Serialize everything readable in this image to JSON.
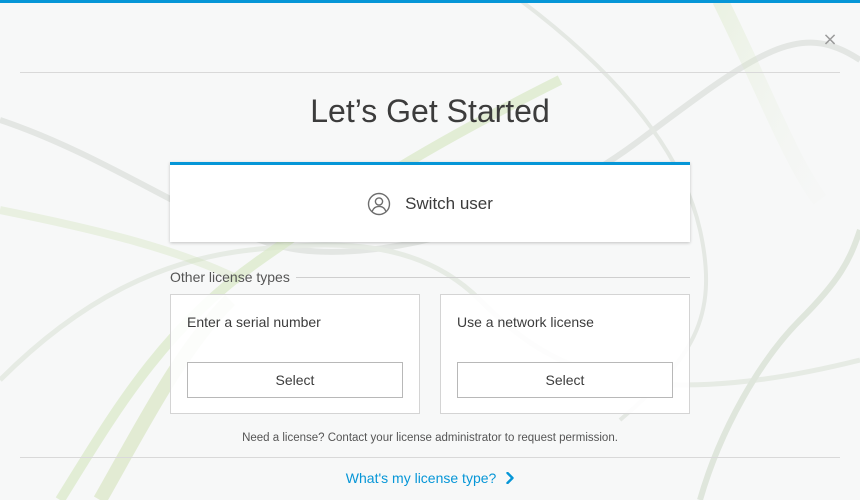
{
  "dialog": {
    "title": "Let’s Get Started",
    "close_symbol": "×",
    "accent_color": "#0696d7"
  },
  "switch_user": {
    "label": "Switch user",
    "icon": "user-circle-icon"
  },
  "other_license": {
    "header": "Other license types",
    "options": [
      {
        "label": "Enter a serial number",
        "button": "Select"
      },
      {
        "label": "Use a network license",
        "button": "Select"
      }
    ]
  },
  "footer": {
    "need_license": "Need a license? Contact your license administrator to request permission.",
    "link_text": "What's my license type?",
    "link_icon": "chevron-right-icon"
  }
}
